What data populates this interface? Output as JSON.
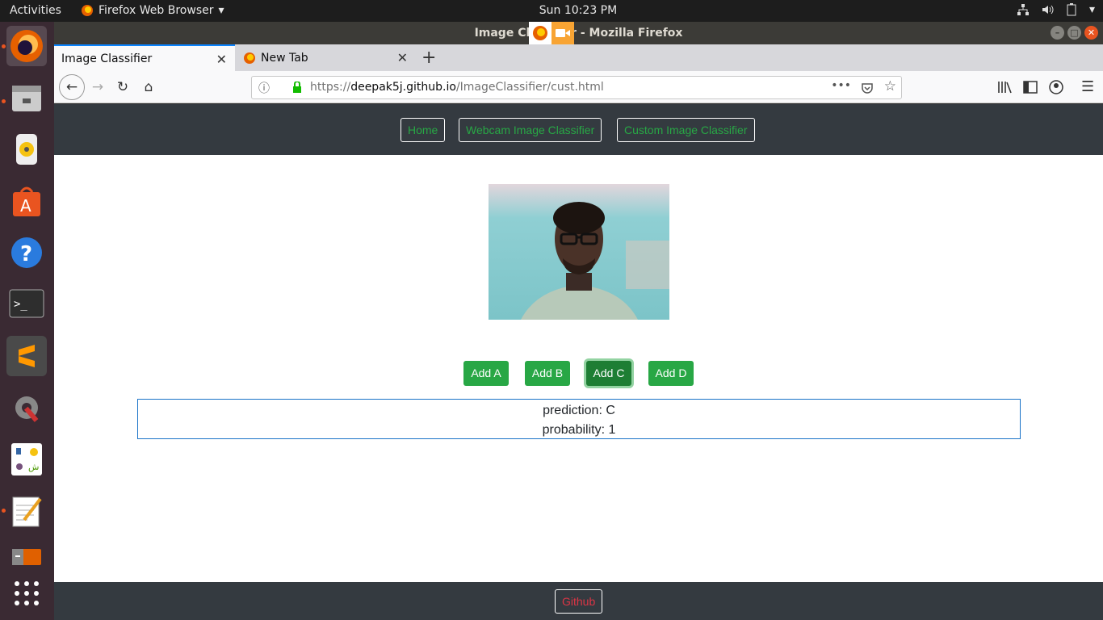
{
  "topbar": {
    "activities": "Activities",
    "app_menu": "Firefox Web Browser",
    "clock": "Sun 10:23 PM"
  },
  "window": {
    "title": "Image Classifier - Mozilla Firefox"
  },
  "tabs": [
    {
      "label": "Image Classifier",
      "selected": true
    },
    {
      "label": "New Tab",
      "selected": false
    }
  ],
  "urlbar": {
    "host_prefix": "https://",
    "host": "deepak5j.github.io",
    "path": "/ImageClassifier/cust.html"
  },
  "site": {
    "nav": [
      "Home",
      "Webcam Image Classifier",
      "Custom Image Classifier"
    ],
    "buttons": [
      "Add A",
      "Add B",
      "Add C",
      "Add D"
    ],
    "prediction_label": "prediction: C",
    "probability_label": "probability: 1",
    "footer_link": "Github"
  },
  "colors": {
    "accent_green": "#28a745",
    "dark_bar": "#343a40",
    "danger": "#dc3545",
    "ubuntu_orange": "#e95420"
  }
}
